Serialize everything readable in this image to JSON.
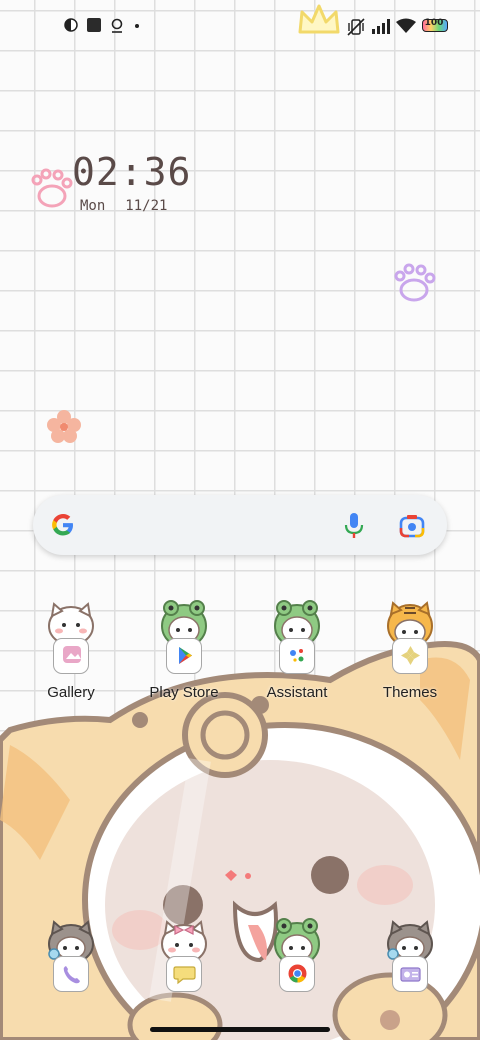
{
  "status_bar": {
    "battery": "100",
    "icons": [
      "theme-circle-icon",
      "square-icon",
      "pin-icon",
      "dot-icon",
      "crown-icon",
      "vibrate-off-icon",
      "signal-icon",
      "wifi-icon",
      "battery-icon"
    ]
  },
  "clock": {
    "time": "02:36",
    "day": "Mon",
    "date": "11/21"
  },
  "search": {
    "icons": [
      "google-logo-icon",
      "mic-icon",
      "lens-icon"
    ]
  },
  "apps_row1": [
    {
      "label": "Gallery",
      "icon": "gallery-icon"
    },
    {
      "label": "Play Store",
      "icon": "play-store-icon"
    },
    {
      "label": "Assistant",
      "icon": "assistant-icon"
    },
    {
      "label": "Themes",
      "icon": "themes-icon"
    }
  ],
  "dock": [
    {
      "icon": "phone-icon"
    },
    {
      "icon": "messages-icon"
    },
    {
      "icon": "chrome-icon"
    },
    {
      "icon": "camera-icon"
    }
  ],
  "colors": {
    "clock": "#5a4a48",
    "cat_fur": "#f7d9a8",
    "grid": "#dedede"
  }
}
